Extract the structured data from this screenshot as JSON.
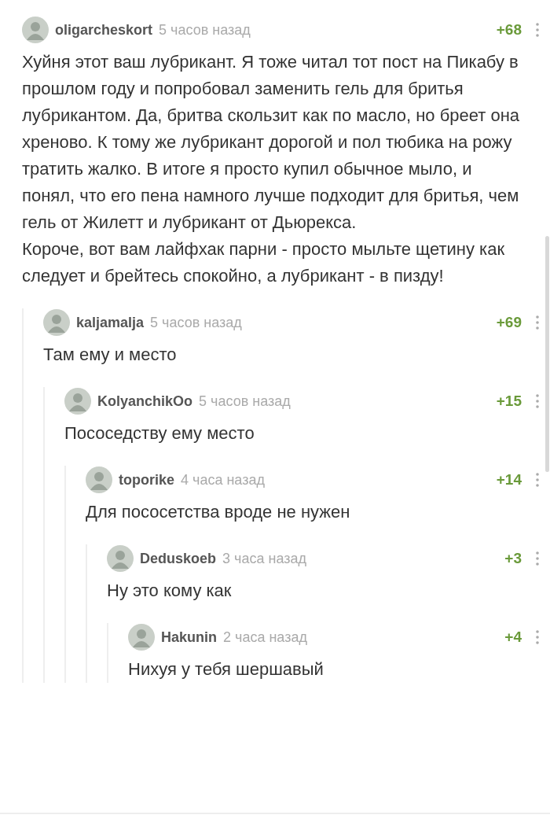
{
  "comments": [
    {
      "author": "oligarcheskort",
      "time": "5 часов назад",
      "rating": "+68",
      "body": "Хуйня этот ваш лубрикант. Я тоже читал тот пост на Пикабу в прошлом году и попробовал заменить гель для бритья лубрикантом. Да, бритва скользит как по масло, но бреет она хреново. К тому же лубрикант дорогой и пол тюбика на рожу тратить жалко. В итоге я просто купил обычное мыло, и понял, что его пена намного лучше подходит для бритья, чем гель от Жилетт и лубрикант от Дьюрекса.\nКороче, вот вам лайфхак парни - просто мыльте щетину как следует и брейтесь спокойно, а лубрикант - в пизду!",
      "children": [
        {
          "author": "kaljamalja",
          "time": "5 часов назад",
          "rating": "+69",
          "body": "Там ему и место",
          "children": [
            {
              "author": "KolyanchikOo",
              "time": "5 часов назад",
              "rating": "+15",
              "body": "Пососедству ему место",
              "children": [
                {
                  "author": "toporike",
                  "time": "4 часа назад",
                  "rating": "+14",
                  "body": "Для пососетства вроде не нужен",
                  "children": [
                    {
                      "author": "Deduskoeb",
                      "time": "3 часа назад",
                      "rating": "+3",
                      "body": "Ну это кому как",
                      "children": [
                        {
                          "author": "Hakunin",
                          "time": "2 часа назад",
                          "rating": "+4",
                          "body": "Нихуя у тебя шершавый"
                        }
                      ]
                    }
                  ]
                }
              ]
            }
          ]
        }
      ]
    }
  ]
}
